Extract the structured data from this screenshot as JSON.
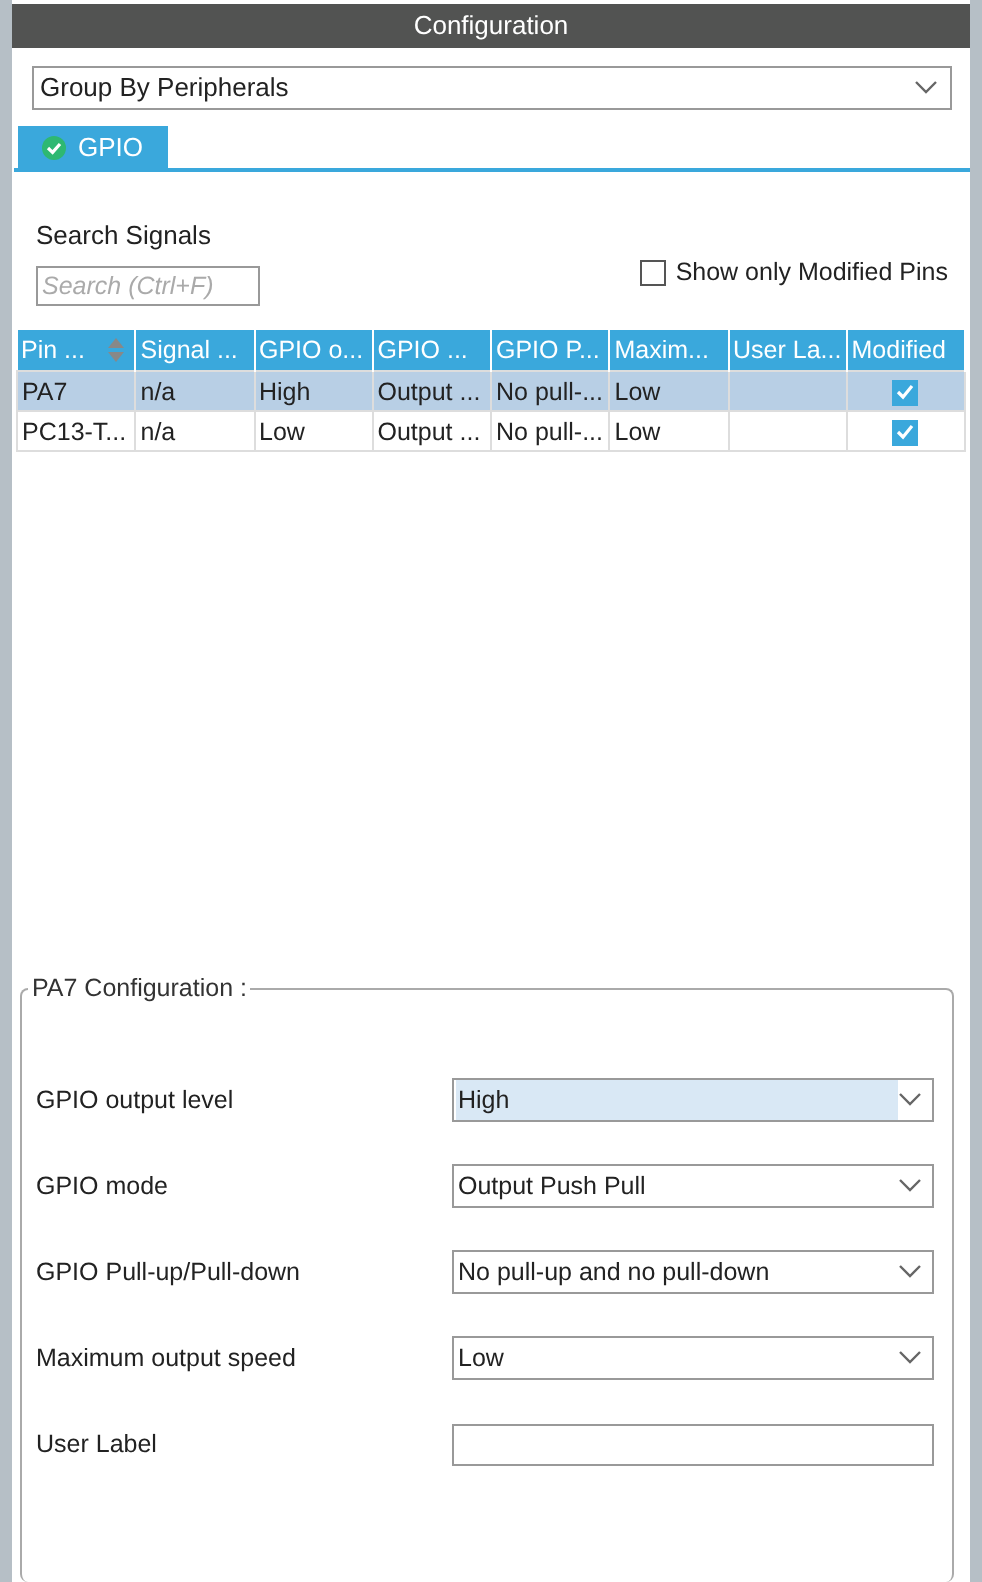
{
  "window": {
    "title": "Configuration"
  },
  "group_by": {
    "value": "Group By Peripherals"
  },
  "tabs": [
    {
      "label": "GPIO",
      "selected": true
    }
  ],
  "search": {
    "label": "Search Signals",
    "placeholder": "Search (Ctrl+F)"
  },
  "show_modified": {
    "label": "Show only Modified Pins",
    "checked": false
  },
  "table": {
    "columns": [
      {
        "label": "Pin ...",
        "sorted": true
      },
      {
        "label": "Signal ...",
        "sorted": false
      },
      {
        "label": "GPIO o...",
        "sorted": false
      },
      {
        "label": "GPIO ...",
        "sorted": false
      },
      {
        "label": "GPIO P...",
        "sorted": false
      },
      {
        "label": "Maxim...",
        "sorted": false
      },
      {
        "label": "User La...",
        "sorted": false
      },
      {
        "label": "Modified",
        "sorted": false
      }
    ],
    "rows": [
      {
        "selected": true,
        "cells": [
          "PA7",
          "n/a",
          "High",
          "Output ...",
          "No pull-...",
          "Low",
          null
        ],
        "modified": true
      },
      {
        "selected": false,
        "cells": [
          "PC13-T...",
          "n/a",
          "Low",
          "Output ...",
          "No pull-...",
          "Low",
          null
        ],
        "modified": true
      }
    ]
  },
  "config": {
    "title": "PA7 Configuration :",
    "fields": [
      {
        "kind": "select",
        "label": "GPIO output level",
        "value": "High",
        "focused": true
      },
      {
        "kind": "select",
        "label": "GPIO mode",
        "value": "Output Push Pull",
        "focused": false
      },
      {
        "kind": "select",
        "label": "GPIO Pull-up/Pull-down",
        "value": "No pull-up and no pull-down",
        "focused": false
      },
      {
        "kind": "select",
        "label": "Maximum output speed",
        "value": "Low",
        "focused": false
      },
      {
        "kind": "text",
        "label": "User Label",
        "focused": false
      }
    ]
  }
}
